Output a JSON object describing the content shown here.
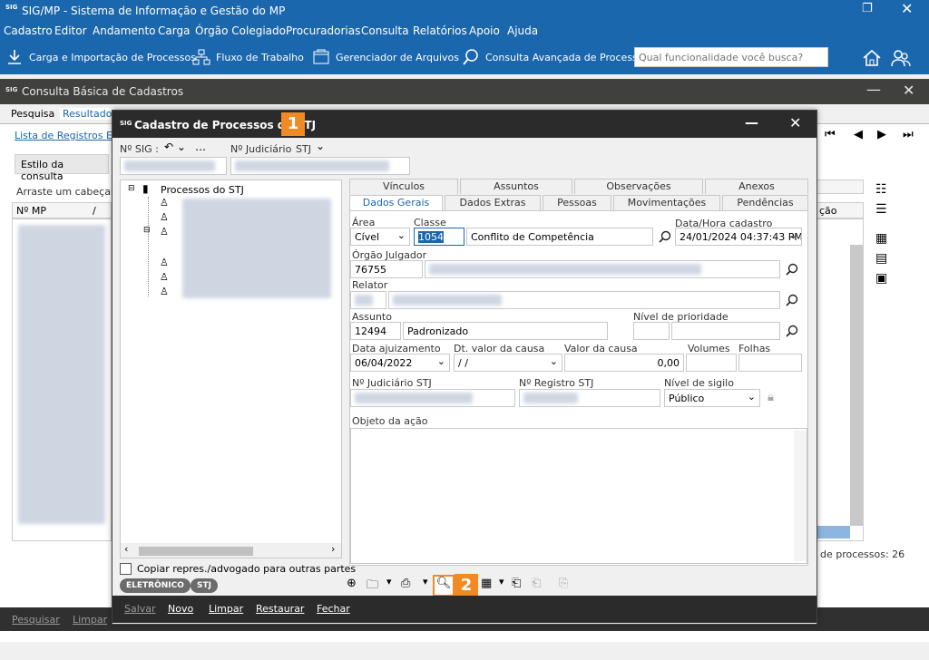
{
  "app": {
    "title": "SIG/MP - Sistema de Informação e Gestão do MP",
    "logo_text": "SIG"
  },
  "menu": [
    "Cadastro",
    "Editor",
    "Andamento",
    "Carga",
    "Órgão Colegiado",
    "Procuradorias",
    "Consulta",
    "Relatórios",
    "Apoio",
    "Ajuda"
  ],
  "toolbar": {
    "carga": "Carga e Importação de Processos",
    "fluxo": "Fluxo de Trabalho",
    "arquivos": "Gerenciador de Arquivos",
    "consulta_avancada": "Consulta Avançada de Processos",
    "search_placeholder": "Qual funcionalidade você busca?"
  },
  "bg": {
    "title": "Consulta Básica de Cadastros",
    "tab_pesquisa": "Pesquisa",
    "tab_resultado": "Resultado",
    "lista": "Lista de Registros En",
    "estilo": "Estilo da consulta",
    "arraste": "Arraste um cabeçalh",
    "col_nmp": "Nº MP",
    "col_slash": "/",
    "col_acao": "ção",
    "total": "de processos: 26",
    "btn_pesquisar": "Pesquisar",
    "btn_limpar": "Limpar"
  },
  "modal": {
    "title": "Cadastro de Processos do STJ",
    "badge1": "1",
    "badge2": "2",
    "nsig_label": "Nº SIG :",
    "njud_label": "Nº Judiciário",
    "njud_stj": "STJ",
    "tree_root": "Processos do STJ",
    "tabs_row1": [
      "Vínculos",
      "Assuntos",
      "Observações",
      "Anexos"
    ],
    "tabs_row2": [
      "Dados Gerais",
      "Dados Extras",
      "Pessoas",
      "Movimentações",
      "Pendências"
    ],
    "area_label": "Área",
    "area_value": "Cível",
    "classe_label": "Classe",
    "classe_code": "1054",
    "classe_desc": "Conflito de Competência",
    "data_label": "Data/Hora cadastro",
    "data_value": "24/01/2024 04:37:43 PM",
    "orgao_label": "Órgão Julgador",
    "orgao_code": "76755",
    "relator_label": "Relator",
    "assunto_label": "Assunto",
    "assunto_code": "12494",
    "assunto_desc": "Padronizado",
    "prioridade_label": "Nível de prioridade",
    "ajuiz_label": "Data ajuizamento",
    "ajuiz_value": "06/04/2022",
    "dtvalor_label": "Dt. valor da causa",
    "dtvalor_value": "/  /",
    "valor_label": "Valor da causa",
    "valor_value": "0,00",
    "volumes_label": "Volumes",
    "folhas_label": "Folhas",
    "njudstj_label": "Nº Judiciário STJ",
    "nregstj_label": "Nº Registro STJ",
    "sigilo_label": "Nível de sigilo",
    "sigilo_value": "Público",
    "objeto_label": "Objeto da ação",
    "copiar_label": "Copiar repres./advogado para outras partes",
    "pill1": "ELETRÔNICO",
    "pill2": "STJ",
    "btn_salvar": "Salvar",
    "btn_novo": "Novo",
    "btn_limpar": "Limpar",
    "btn_restaurar": "Restaurar",
    "btn_fechar": "Fechar"
  }
}
